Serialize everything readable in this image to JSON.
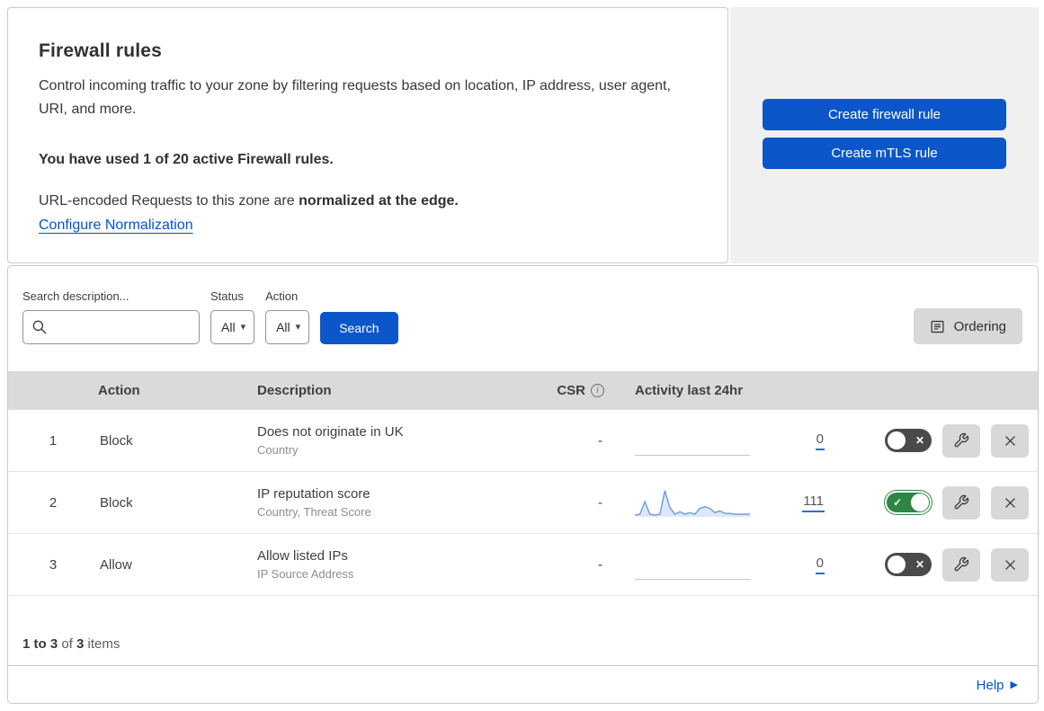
{
  "panel": {
    "title": "Firewall rules",
    "description": "Control incoming traffic to your zone by filtering requests based on location, IP address, user agent, URI, and more.",
    "usage": "You have used 1 of 20 active Firewall rules.",
    "normalization_text": "URL-encoded Requests to this zone are ",
    "normalization_bold": "normalized at the edge.",
    "normalization_link": "Configure Normalization"
  },
  "actions": {
    "create_firewall_rule": "Create firewall rule",
    "create_mtls_rule": "Create mTLS rule"
  },
  "filters": {
    "search_label": "Search description...",
    "search_value": "",
    "status_label": "Status",
    "status_value": "All",
    "action_label": "Action",
    "action_value": "All",
    "search_button": "Search",
    "ordering_button": "Ordering"
  },
  "table": {
    "headers": {
      "action": "Action",
      "description": "Description",
      "csr": "CSR",
      "activity": "Activity last 24hr"
    },
    "rows": [
      {
        "index": "1",
        "action": "Block",
        "description": "Does not originate in UK",
        "fields": "Country",
        "csr": "-",
        "activity_count": "0",
        "enabled": false
      },
      {
        "index": "2",
        "action": "Block",
        "description": "IP reputation score",
        "fields": "Country, Threat Score",
        "csr": "-",
        "activity_count": "111",
        "enabled": true,
        "sparkline": [
          1,
          2,
          17,
          2,
          1,
          2,
          30,
          10,
          2,
          5,
          2,
          4,
          2,
          9,
          11,
          9,
          4,
          6,
          3,
          3,
          2,
          2,
          2,
          2
        ]
      },
      {
        "index": "3",
        "action": "Allow",
        "description": "Allow listed IPs",
        "fields": "IP Source Address",
        "csr": "-",
        "activity_count": "0",
        "enabled": false
      }
    ]
  },
  "footer": {
    "range": "1 to 3",
    "of": " of ",
    "total": "3",
    "items": " items"
  },
  "help": {
    "label": "Help"
  },
  "icons": {
    "toggle_on": "✓",
    "toggle_off": "✕",
    "dropdown_caret": "▾",
    "help_arrow": "▶",
    "info": "i"
  },
  "colors": {
    "primary_blue": "#0b56c9",
    "link_blue": "#0055cc",
    "toggle_on_green": "#2d8644",
    "toggle_off_gray": "#4a4a4a",
    "table_header_gray": "#dadada",
    "actions_panel_gray": "#f0f0f1",
    "sparkline_blue": "#699be0",
    "sparkline_fill": "#dce8f8",
    "count_underline_blue": "#2f6bce"
  }
}
